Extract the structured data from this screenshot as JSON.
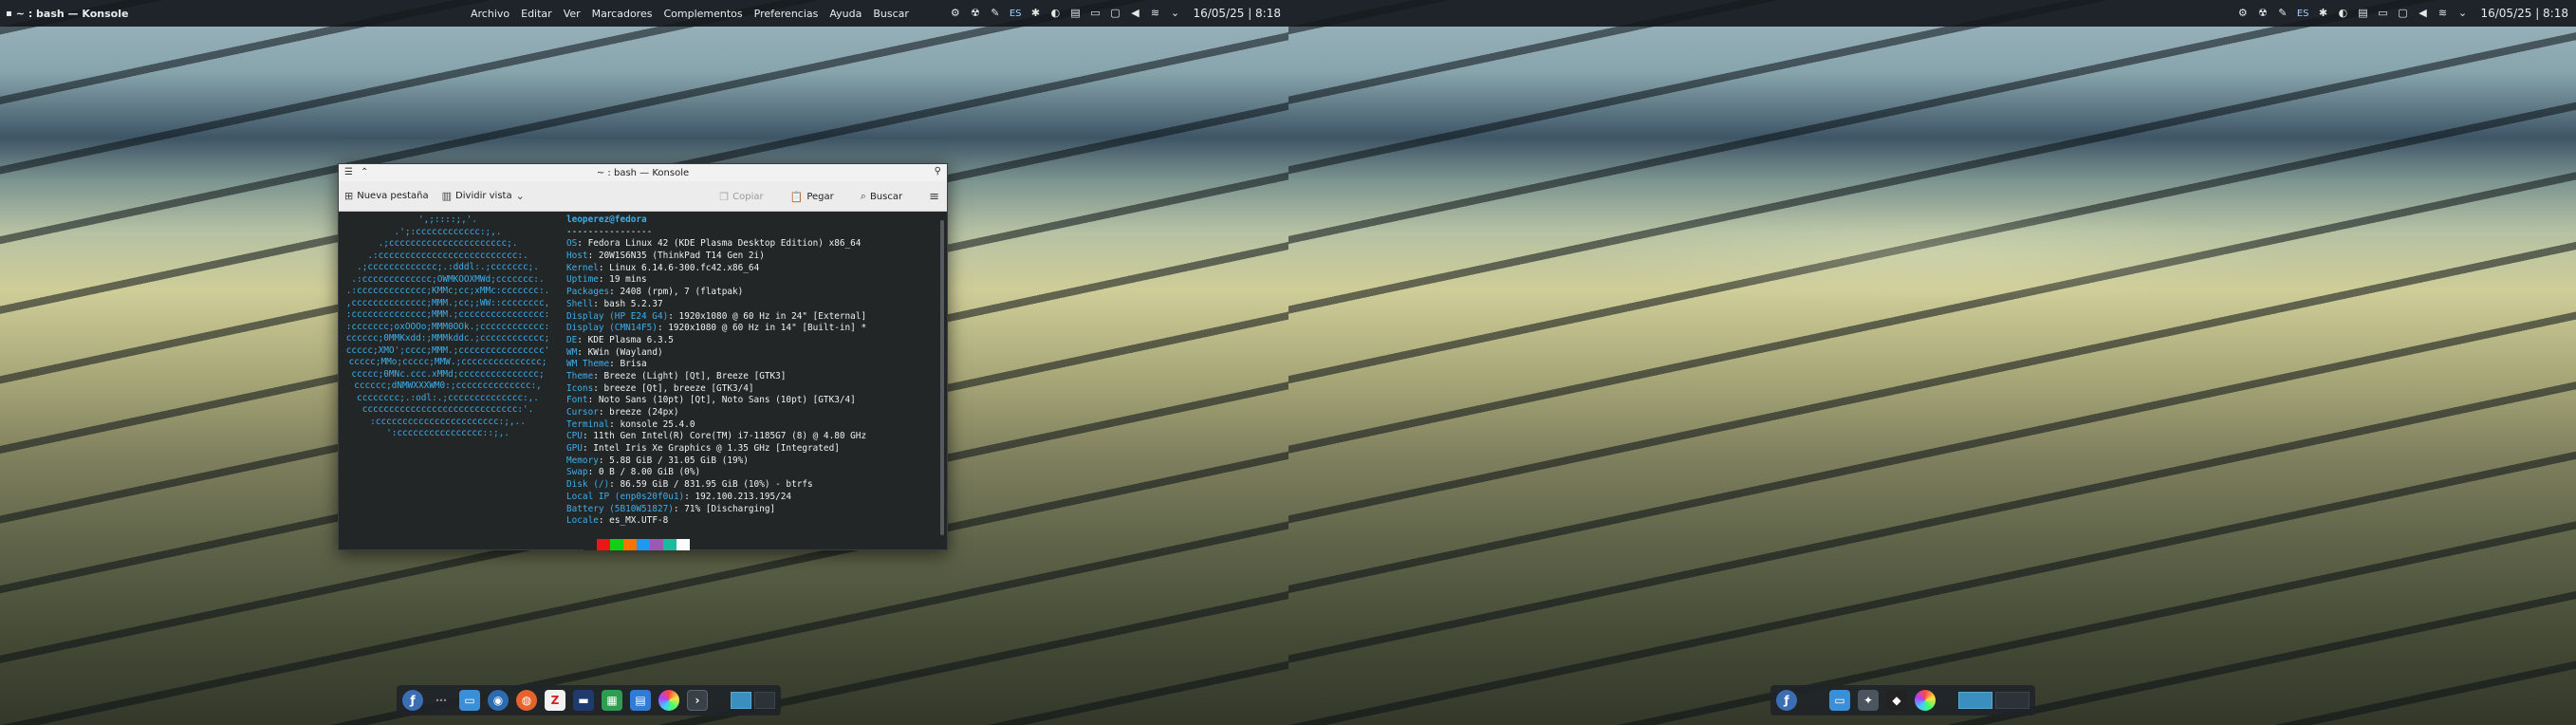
{
  "left_panel": {
    "app_title": "~ : bash — Konsole",
    "menus": [
      "Archivo",
      "Editar",
      "Ver",
      "Marcadores",
      "Complementos",
      "Preferencias",
      "Ayuda",
      "Buscar"
    ],
    "lang": "ES",
    "clock": "16/05/25 | 8:18"
  },
  "right_panel": {
    "lang": "ES",
    "clock": "16/05/25 | 8:18"
  },
  "konsole": {
    "title": "~ : bash — Konsole",
    "toolbar": {
      "new_tab": "Nueva pestaña",
      "split_view": "Dividir vista",
      "copy": "Copiar",
      "paste": "Pegar",
      "search": "Buscar"
    },
    "fastfetch": {
      "user": "leoperez@fedora",
      "separator": "----------------",
      "rows": [
        {
          "k": "OS",
          "v": "Fedora Linux 42 (KDE Plasma Desktop Edition) x86_64"
        },
        {
          "k": "Host",
          "v": "20W1S6N35 (ThinkPad T14 Gen 2i)"
        },
        {
          "k": "Kernel",
          "v": "Linux 6.14.6-300.fc42.x86_64"
        },
        {
          "k": "Uptime",
          "v": "19 mins"
        },
        {
          "k": "Packages",
          "v": "2408 (rpm), 7 (flatpak)"
        },
        {
          "k": "Shell",
          "v": "bash 5.2.37"
        },
        {
          "k": "Display (HP E24 G4)",
          "v": "1920x1080 @ 60 Hz in 24\" [External]"
        },
        {
          "k": "Display (CMN14F5)",
          "v": "1920x1080 @ 60 Hz in 14\" [Built-in] *"
        },
        {
          "k": "DE",
          "v": "KDE Plasma 6.3.5"
        },
        {
          "k": "WM",
          "v": "KWin (Wayland)"
        },
        {
          "k": "WM Theme",
          "v": "Brisa"
        },
        {
          "k": "Theme",
          "v": "Breeze (Light) [Qt], Breeze [GTK3]"
        },
        {
          "k": "Icons",
          "v": "breeze [Qt], breeze [GTK3/4]"
        },
        {
          "k": "Font",
          "v": "Noto Sans (10pt) [Qt], Noto Sans (10pt) [GTK3/4]"
        },
        {
          "k": "Cursor",
          "v": "breeze (24px)"
        },
        {
          "k": "Terminal",
          "v": "konsole 25.4.0"
        },
        {
          "k": "CPU",
          "v": "11th Gen Intel(R) Core(TM) i7-1185G7 (8) @ 4.80 GHz"
        },
        {
          "k": "GPU",
          "v": "Intel Iris Xe Graphics @ 1.35 GHz [Integrated]"
        },
        {
          "k": "Memory",
          "v": "5.88 GiB / 31.05 GiB (19%)"
        },
        {
          "k": "Swap",
          "v": "0 B / 8.00 GiB (0%)"
        },
        {
          "k": "Disk (/)",
          "v": "86.59 GiB / 831.95 GiB (10%) - btrfs"
        },
        {
          "k": "Local IP (enp0s20f0u1)",
          "v": "192.100.213.195/24"
        },
        {
          "k": "Battery (5B10W51827)",
          "v": "71% [Discharging]"
        },
        {
          "k": "Locale",
          "v": "es_MX.UTF-8"
        }
      ],
      "logo": [
        "',;::::;,'.",
        ".';:cccccccccccc:;,.",
        ".;cccccccccccccccccccccc;.",
        ".:cccccccccccccccccccccccccc:.",
        ".;ccccccccccccc;.:dddl:.;ccccccc;.",
        ".:ccccccccccccc;OWMKOOXMWd;ccccccc:.",
        ".:ccccccccccccc;KMMc;cc;xMMc:ccccccc:.",
        ",cccccccccccccc;MMM.;cc;;WW::cccccccc,",
        ":cccccccccccccc;MMM.;cccccccccccccccc:",
        ":ccccccc;oxOOOo;MMM0OOk.;cccccccccccc:",
        "cccccc;0MMKxdd:;MMMkddc.;cccccccccccc;",
        "ccccc;XMO';cccc;MMM.;cccccccccccccccc'",
        "ccccc;MMo;ccccc;MMW.;ccccccccccccccc;",
        "ccccc;0MNc.ccc.xMMd;ccccccccccccccc;",
        "cccccc;dNMWXXXWM0:;cccccccccccccc:,",
        "cccccccc;.:odl:.;cccccccccccccc:,.",
        "ccccccccccccccccccccccccccccc:'.",
        ":ccccccccccccccccccccccc:;,..",
        "':cccccccccccccccc::;,."
      ],
      "palette": [
        "#232627",
        "#ed1515",
        "#11d116",
        "#f67400",
        "#1d99f3",
        "#9b59b6",
        "#1abc9c",
        "#fcfcfc"
      ]
    }
  },
  "dock_left": [
    "fedora-icon",
    "dots-icon",
    "files-icon",
    "discover-icon",
    "firefox-icon",
    "zotero-icon",
    "monitor-icon",
    "sheet-icon",
    "doc-icon",
    "color-icon",
    "terminal-icon"
  ],
  "dock_right": [
    "fedora-icon",
    "files-icon",
    "app-icon",
    "inkscape-icon",
    "color-icon"
  ]
}
